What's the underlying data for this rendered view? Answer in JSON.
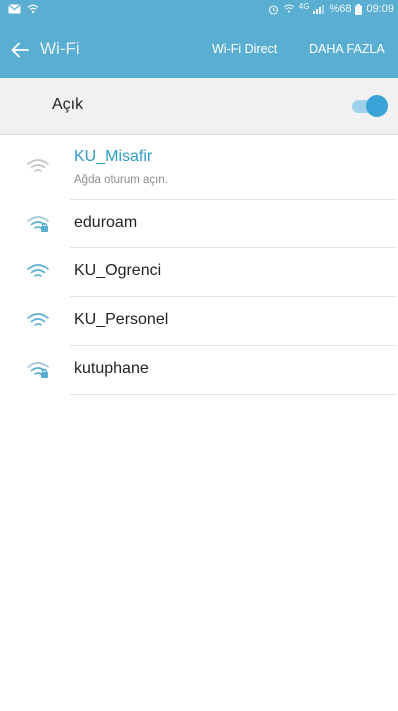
{
  "status_bar": {
    "battery": "%68",
    "time": "09:09",
    "network_type": "4G"
  },
  "header": {
    "back_icon": "arrow-left-icon",
    "title": "Wi-Fi",
    "actions": [
      "Wi-Fi Direct",
      "DAHA FAZLA"
    ]
  },
  "master_switch": {
    "label": "Açık",
    "state": "on"
  },
  "networks": [
    {
      "name": "KU_Misafir",
      "subtitle": "Ağda oturum açın.",
      "secured": false,
      "highlighted": true
    },
    {
      "name": "eduroam",
      "subtitle": "",
      "secured": true,
      "highlighted": false
    },
    {
      "name": "KU_Ogrenci",
      "subtitle": "",
      "secured": false,
      "highlighted": false
    },
    {
      "name": "KU_Personel",
      "subtitle": "",
      "secured": false,
      "highlighted": false
    },
    {
      "name": "kutuphane",
      "subtitle": "",
      "secured": true,
      "highlighted": false
    }
  ],
  "colors": {
    "accent": "#5aaed2",
    "highlight": "#2e9bc4",
    "toggle_on": "#3aa3d8"
  }
}
